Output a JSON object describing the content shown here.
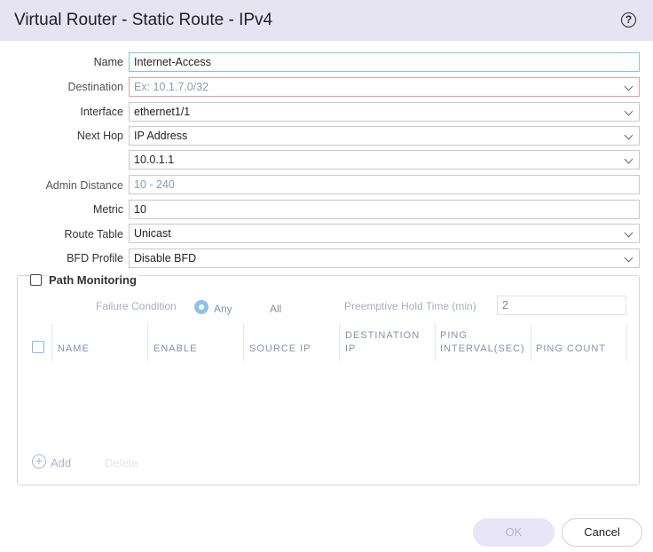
{
  "dialog": {
    "title": "Virtual Router - Static Route - IPv4",
    "help_glyph": "?"
  },
  "form": {
    "name_label": "Name",
    "name_value": "Internet-Access",
    "destination_label": "Destination",
    "destination_placeholder": "Ex: 10.1.7.0/32",
    "interface_label": "Interface",
    "interface_value": "ethernet1/1",
    "next_hop_label": "Next Hop",
    "next_hop_type": "IP Address",
    "next_hop_value": "10.0.1.1",
    "admin_distance_label": "Admin Distance",
    "admin_distance_placeholder": "10 - 240",
    "metric_label": "Metric",
    "metric_value": "10",
    "route_table_label": "Route Table",
    "route_table_value": "Unicast",
    "bfd_label": "BFD Profile",
    "bfd_value": "Disable BFD"
  },
  "path_monitoring": {
    "label": "Path Monitoring",
    "failure_condition_label": "Failure Condition",
    "option_any": "Any",
    "option_all": "All",
    "hold_time_label": "Preemptive Hold Time (min)",
    "hold_time_value": "2",
    "columns": [
      "NAME",
      "ENABLE",
      "SOURCE IP",
      "DESTINATION IP",
      "PING INTERVAL(SEC)",
      "PING COUNT"
    ],
    "add_label": "Add",
    "delete_label": "Delete"
  },
  "footer": {
    "ok_label": "OK",
    "cancel_label": "Cancel"
  }
}
